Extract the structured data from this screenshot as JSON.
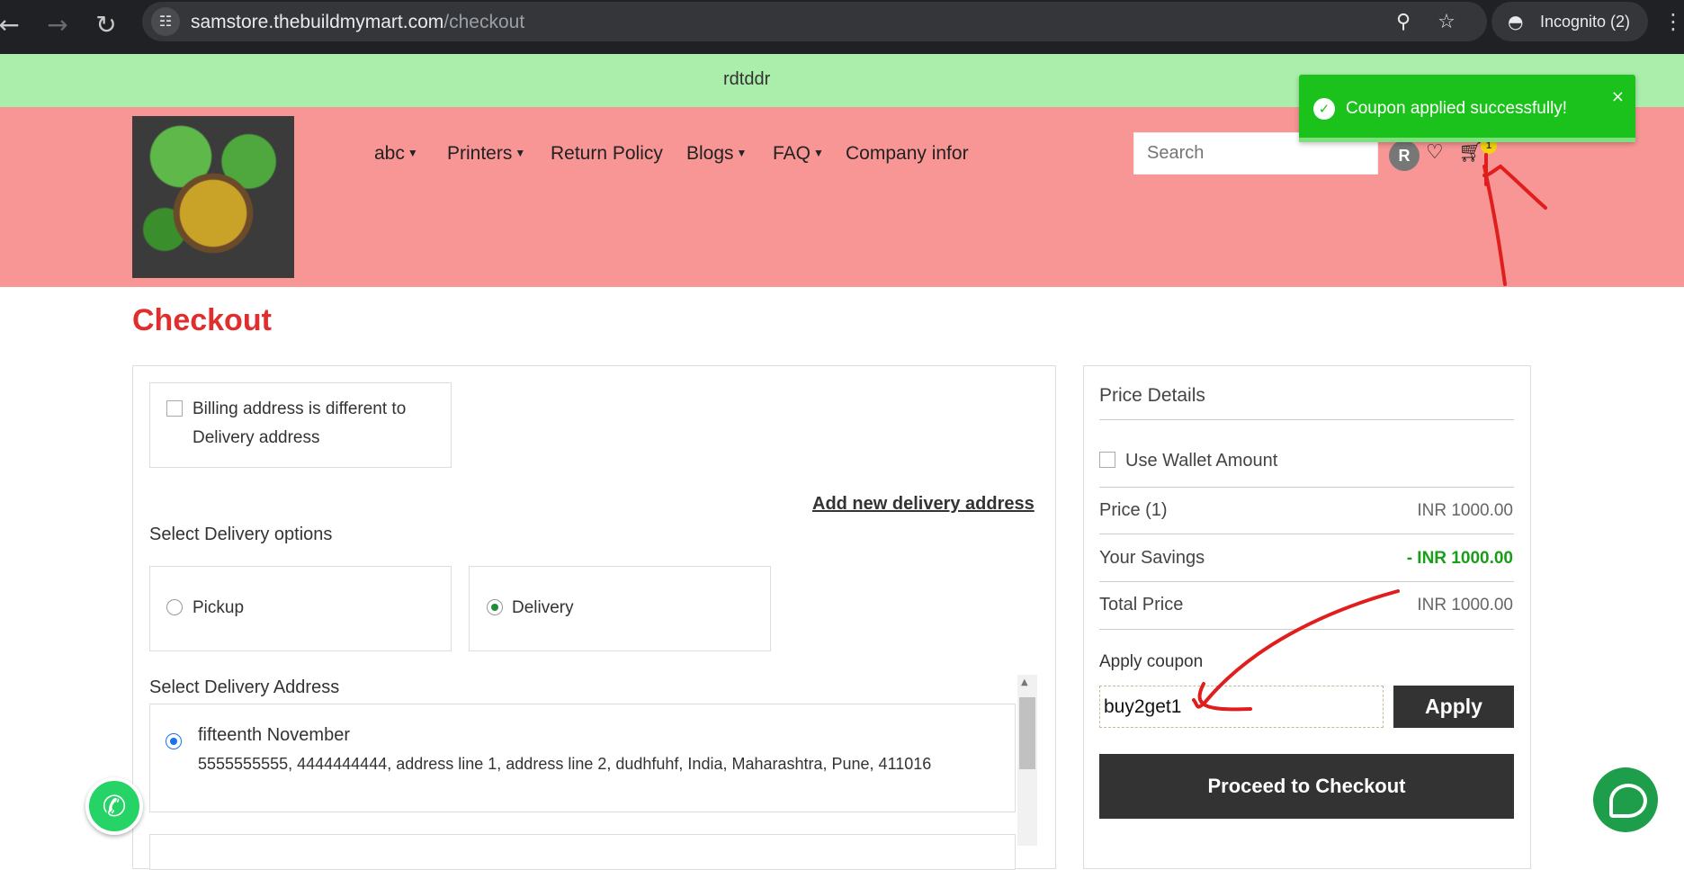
{
  "browser": {
    "url_host": "samstore.thebuildmymart.com",
    "url_path": "/checkout",
    "incognito_label": "Incognito (2)",
    "icons": [
      "back-arrow-icon",
      "forward-arrow-icon",
      "reload-icon",
      "site-settings-icon",
      "zoom-icon",
      "star-icon",
      "incognito-icon"
    ]
  },
  "announcement": {
    "text": "rdtddr"
  },
  "header": {
    "menu": [
      {
        "label": "abc",
        "dropdown": true
      },
      {
        "label": "Printers",
        "dropdown": true
      },
      {
        "label": "Return Policy",
        "dropdown": false
      },
      {
        "label": "Blogs",
        "dropdown": true
      },
      {
        "label": "FAQ",
        "dropdown": true
      },
      {
        "label": "Company infor",
        "dropdown": false
      }
    ],
    "search_placeholder": "Search",
    "avatar_letter": "R",
    "cart_count": "1"
  },
  "toast": {
    "message": "Coupon applied successfully!",
    "close": "×"
  },
  "checkout": {
    "title": "Checkout",
    "billing_checkbox_line1": "Billing address is different to",
    "billing_checkbox_line2": "Delivery address",
    "add_address_link": "Add new delivery address",
    "delivery_options_heading": "Select Delivery options",
    "options": [
      {
        "label": "Pickup",
        "selected": false
      },
      {
        "label": "Delivery",
        "selected": true
      }
    ],
    "address_heading": "Select Delivery Address",
    "address": {
      "name": "fifteenth November",
      "details": "5555555555, 4444444444, address line 1, address line 2, dudhfuhf, India, Maharashtra, Pune, 411016",
      "selected": true
    }
  },
  "price_details": {
    "title": "Price Details",
    "wallet_label": "Use Wallet Amount",
    "rows": [
      {
        "label": "Price (1)",
        "value": "INR 1000.00"
      },
      {
        "label": "Your Savings",
        "value": "- INR 1000.00"
      },
      {
        "label": "Total Price",
        "value": "INR 1000.00"
      }
    ],
    "coupon_label": "Apply coupon",
    "coupon_value": "buy2get1",
    "apply_label": "Apply",
    "proceed_label": "Proceed to Checkout"
  },
  "colors": {
    "announcement_bg": "#abedab",
    "header_bg": "#f89595",
    "title_red": "#e02e2e",
    "toast_green": "#1cc21c",
    "savings_green": "#1a9e1a",
    "button_dark": "#333333",
    "annotation_red": "#e01e1e"
  }
}
